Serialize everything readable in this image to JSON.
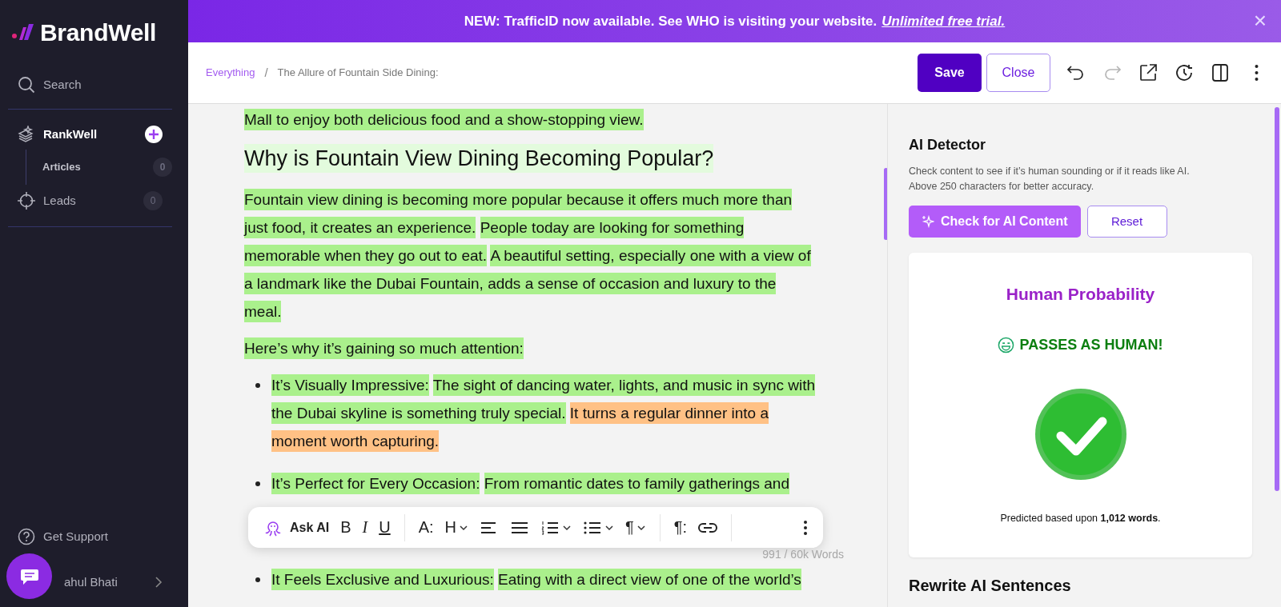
{
  "sidebar": {
    "brand": "BrandWell",
    "search": "Search",
    "items": [
      {
        "label": "RankWell",
        "selected": true,
        "children": [
          {
            "label": "Articles",
            "count": "0",
            "selected": false
          }
        ]
      },
      {
        "label": "Leads",
        "count": "0",
        "selected": false
      }
    ],
    "support": "Get Support",
    "user": "ahul Bhati"
  },
  "banner": {
    "message": "NEW: TrafficID now available. See WHO is visiting your website.",
    "link": "Unlimited free trial.",
    "close": "×"
  },
  "header": {
    "breadcrumbs": [
      "Everything",
      "The Allure of Fountain Side Dining:"
    ],
    "breadcrumb_separator": "/",
    "save": "Save",
    "close": "Close",
    "actions": [
      {
        "kind": "undo",
        "disabled": false
      },
      {
        "kind": "redo",
        "disabled": true
      },
      {
        "kind": "open",
        "disabled": false
      },
      {
        "kind": "history",
        "disabled": false
      },
      {
        "kind": "panel",
        "disabled": false
      },
      {
        "kind": "more",
        "disabled": false
      }
    ]
  },
  "editor": {
    "blocks": [
      {
        "kind": "paragraph",
        "lines": [
          [
            {
              "text": "Mall to enjoy both delicious food and a show-stopping view.",
              "color": "#aaf08c"
            }
          ]
        ]
      },
      {
        "kind": "heading",
        "lines": [
          [
            {
              "text": "Why is Fountain View Dining Becoming Popular?",
              "color": "#e3fbdd"
            }
          ]
        ]
      },
      {
        "kind": "paragraph",
        "lines": [
          [
            {
              "text": "Fountain view dining is becoming more popular because it offers much more than",
              "color": "#aaf08c"
            }
          ],
          [
            {
              "text": "just food, it creates an experience.",
              "color": "#aaf08c"
            },
            {
              "text": "People today are looking for something",
              "color": "#aaf08c"
            }
          ],
          [
            {
              "text": "memorable when they go out to eat.",
              "color": "#aaf08c"
            },
            {
              "text": "A beautiful setting, especially one with a view of",
              "color": "#aaf08c"
            }
          ],
          [
            {
              "text": "a landmark like the Dubai Fountain, adds a sense of occasion and luxury to the",
              "color": "#aaf08c"
            }
          ],
          [
            {
              "text": "meal.",
              "color": "#aaf08c"
            }
          ]
        ]
      },
      {
        "kind": "paragraph",
        "lines": [
          [
            {
              "text": "Here’s why it’s gaining so much attention:",
              "color": "#aaf08c"
            }
          ]
        ]
      },
      {
        "kind": "bullet",
        "lines": [
          [
            {
              "text": "It’s Visually Impressive:",
              "color": "#aaf08c"
            },
            {
              "text": "The sight of dancing water, lights, and music in sync with",
              "color": "#aaf08c"
            }
          ],
          [
            {
              "text": "the Dubai skyline is something truly special.",
              "color": "#aaf08c"
            },
            {
              "text": "It turns a regular dinner into a",
              "color": "#ffc185"
            }
          ],
          [
            {
              "text": "moment worth capturing.",
              "color": "#ffc185"
            }
          ]
        ]
      },
      {
        "kind": "bullet",
        "lines": [
          [
            {
              "text": "It’s Perfect for Every Occasion:",
              "color": "#aaf08c"
            },
            {
              "text": "From romantic dates to family gatherings and",
              "color": "#aaf08c"
            }
          ]
        ]
      },
      {
        "kind": "toolbar"
      },
      {
        "kind": "bullet",
        "lines": [
          [
            {
              "text": "It Feels Exclusive and Luxurious:",
              "color": "#aaf08c"
            },
            {
              "text": "Eating with a direct view of one of the world’s",
              "color": "#aaf08c"
            }
          ]
        ]
      }
    ],
    "toolbar": {
      "ask_ai": "Ask AI",
      "bold": "B",
      "italic": "I",
      "underline": "U",
      "font_size": "A:",
      "heading": "H",
      "paragraph": "¶",
      "paragraph_marks": "¶:"
    },
    "word_count": "991 / 60k Words"
  },
  "detector": {
    "title": "AI Detector",
    "description": "Check content to see if it’s human sounding or if it reads like AI. Above 250 characters for better accuracy.",
    "check_button": "Check for AI Content",
    "reset_button": "Reset",
    "result": {
      "title": "Human Probability",
      "verdict": "PASSES AS HUMAN!",
      "footnote": "Predicted based upon **1,012 words**."
    },
    "next_section": "Rewrite AI Sentences"
  }
}
